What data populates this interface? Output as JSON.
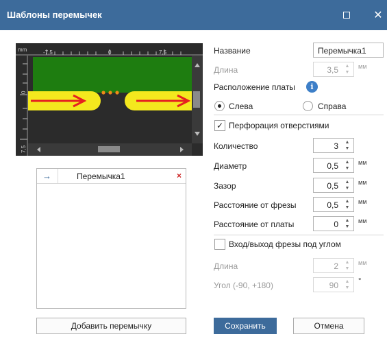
{
  "window": {
    "title": "Шаблоны перемычек",
    "maximize_icon": "maximize-icon",
    "close_icon": "close-icon"
  },
  "preview": {
    "ruler_unit": "mm",
    "ruler_x_ticks": [
      "-7,5",
      "0",
      "7,5"
    ],
    "ruler_y_ticks": [
      "0",
      "7,5"
    ],
    "colors": {
      "board": "#1e7d10",
      "background": "#2b2b2b",
      "track": "#f4e81e",
      "arrow": "#e62020",
      "hole": "#f08a18"
    }
  },
  "jumpers": {
    "items": [
      {
        "arrow": "→",
        "name": "Перемычка1",
        "delete": "×"
      }
    ],
    "add_button": "Добавить перемычку"
  },
  "form": {
    "name_label": "Название",
    "name_value": "Перемычка1",
    "length_label": "Длина",
    "length_value": "3,5",
    "length_unit": "мм",
    "board_position_label": "Расположение платы",
    "info_glyph": "i",
    "position_options": [
      {
        "label": "Слева",
        "selected": true
      },
      {
        "label": "Справа",
        "selected": false
      }
    ],
    "perforation_label": "Перфорация отверстиями",
    "perforation_checked": true,
    "count_label": "Количество",
    "count_value": "3",
    "diameter_label": "Диаметр",
    "diameter_value": "0,5",
    "diameter_unit": "мм",
    "gap_label": "Зазор",
    "gap_value": "0,5",
    "gap_unit": "мм",
    "mill_distance_label": "Расстояние от фрезы",
    "mill_distance_value": "0,5",
    "mill_distance_unit": "мм",
    "board_distance_label": "Расстояние от платы",
    "board_distance_value": "0",
    "board_distance_unit": "мм",
    "angled_label": "Вход/выход фрезы под углом",
    "angled_checked": false,
    "angled_length_label": "Длина",
    "angled_length_value": "2",
    "angled_length_unit": "мм",
    "angle_label": "Угол (-90, +180)",
    "angle_value": "90",
    "angle_unit": "°",
    "spinner_glyph": "▲\n▼"
  },
  "buttons": {
    "save": "Сохранить",
    "cancel": "Отмена"
  }
}
